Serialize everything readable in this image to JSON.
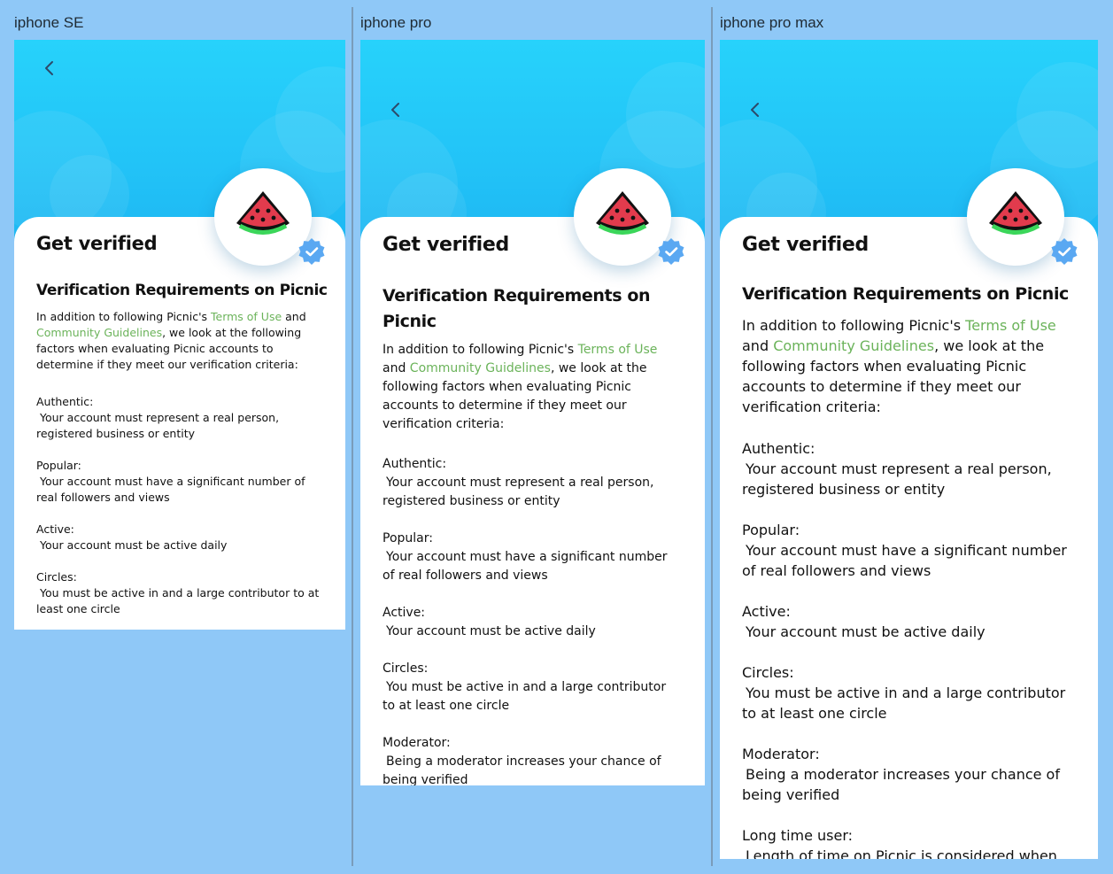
{
  "colors": {
    "background": "#8fc8f7",
    "hero": "#22c3f7",
    "link": "#6bb35a",
    "badge": "#5aa8f2"
  },
  "screens": [
    {
      "label": "iphone SE",
      "title": "Get verified",
      "section": "Verification Requirements on Picnic",
      "intro": {
        "p1": "In addition to following Picnic's ",
        "terms": "Terms of Use",
        "p2": " and ",
        "community": "Community Guidelines",
        "p3": ", we look at the following factors when evaluating Picnic accounts to determine if they meet our verification criteria:"
      },
      "items": [
        {
          "head": "Authentic:",
          "desc": " Your account must represent a real person, registered business or entity"
        },
        {
          "head": " Popular:",
          "desc": " Your account must have a significant number of real followers and views"
        },
        {
          "head": "Active:",
          "desc": " Your account must be active daily"
        },
        {
          "head": "Circles:",
          "desc": " You must be active in and a large contributor to at least one circle"
        }
      ]
    },
    {
      "label": "iphone pro",
      "title": "Get verified",
      "section": "Verification Requirements on Picnic",
      "intro": {
        "p1": "In addition to following Picnic's ",
        "terms": "Terms of Use",
        "p2": " and ",
        "community": "Community Guidelines",
        "p3": ", we look at the following factors when evaluating Picnic accounts to determine if they meet our verification criteria:"
      },
      "items": [
        {
          "head": "Authentic:",
          "desc": " Your account must represent a real person, registered business or entity"
        },
        {
          "head": " Popular:",
          "desc": " Your account must have a significant number of real followers and views"
        },
        {
          "head": "Active:",
          "desc": " Your account must be active daily"
        },
        {
          "head": "Circles:",
          "desc": " You must be active in and a large contributor to at least one circle"
        },
        {
          "head": "Moderator:",
          "desc": " Being a moderator increases your chance of being verified"
        }
      ]
    },
    {
      "label": "iphone pro max",
      "title": "Get verified",
      "section": "Verification Requirements on Picnic",
      "intro": {
        "p1": "In addition to following Picnic's ",
        "terms": "Terms of Use",
        "p2": " and ",
        "community": "Community Guidelines",
        "p3": ", we look at the following factors when evaluating Picnic accounts to determine if they meet our verification criteria:"
      },
      "items": [
        {
          "head": "Authentic:",
          "desc": " Your account must represent a real person, registered business or entity"
        },
        {
          "head": " Popular:",
          "desc": " Your account must have a significant number of real followers and views"
        },
        {
          "head": "Active:",
          "desc": " Your account must be active daily"
        },
        {
          "head": "Circles:",
          "desc": " You must be active in and a large contributor to at least one circle"
        },
        {
          "head": "Moderator:",
          "desc": " Being a moderator increases your chance of being verified"
        },
        {
          "head": "Long time user:",
          "desc": " Length of time on Picnic is considered when"
        }
      ]
    }
  ],
  "icons": {
    "back": "chevron-left-icon",
    "avatar": "watermelon-icon",
    "badge": "verified-badge-icon",
    "item": "missing-glyph-icon"
  }
}
